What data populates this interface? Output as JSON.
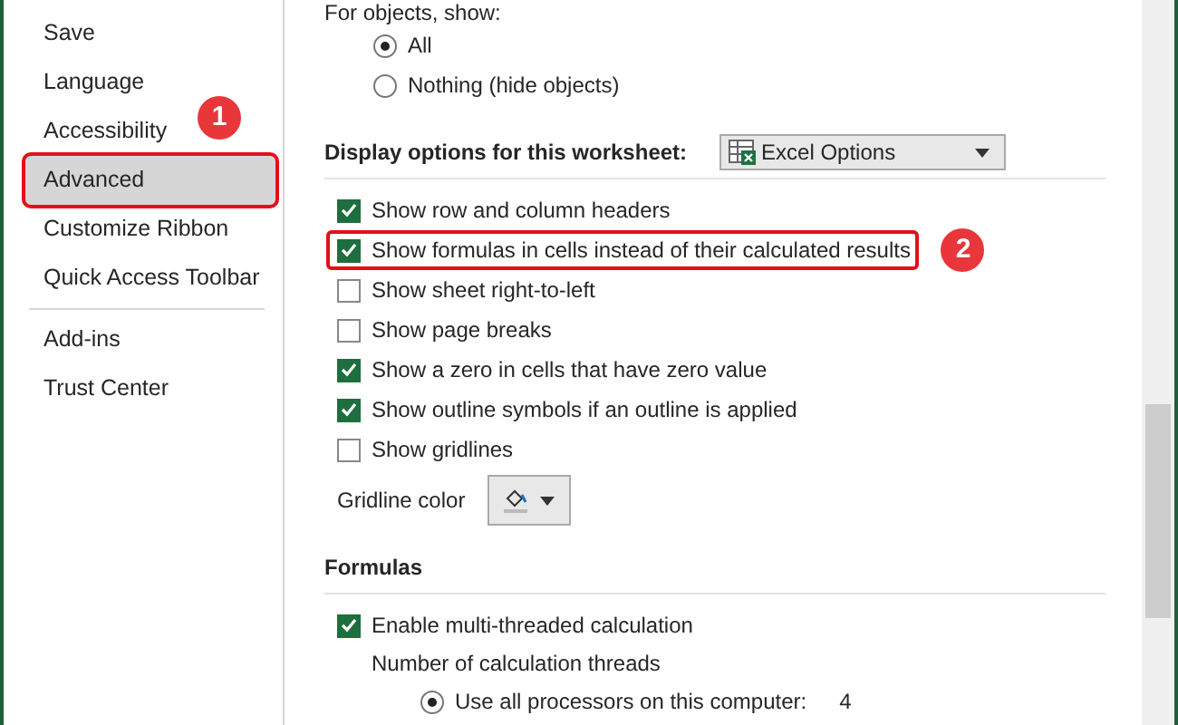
{
  "sidebar": {
    "items": [
      {
        "label": "Save",
        "selected": false
      },
      {
        "label": "Language",
        "selected": false
      },
      {
        "label": "Accessibility",
        "selected": false,
        "badge": "1"
      },
      {
        "label": "Advanced",
        "selected": true,
        "highlighted": true
      },
      {
        "label": "Customize Ribbon",
        "selected": false
      },
      {
        "label": "Quick Access Toolbar",
        "selected": false,
        "divider_after": true
      },
      {
        "label": "Add-ins",
        "selected": false
      },
      {
        "label": "Trust Center",
        "selected": false
      }
    ]
  },
  "objects": {
    "label": "For objects, show:",
    "options": [
      {
        "label": "All",
        "selected": true
      },
      {
        "label": "Nothing (hide objects)",
        "selected": false
      }
    ]
  },
  "display": {
    "heading": "Display options for this worksheet:",
    "dropdown": "Excel Options",
    "checkboxes": [
      {
        "label": "Show row and column headers",
        "checked": true
      },
      {
        "label": "Show formulas in cells instead of their calculated results",
        "checked": true,
        "highlighted": true,
        "badge": "2"
      },
      {
        "label": "Show sheet right-to-left",
        "checked": false
      },
      {
        "label": "Show page breaks",
        "checked": false
      },
      {
        "label": "Show a zero in cells that have zero value",
        "checked": true
      },
      {
        "label": "Show outline symbols if an outline is applied",
        "checked": true
      },
      {
        "label": "Show gridlines",
        "checked": false
      }
    ],
    "gridline_color_label": "Gridline color"
  },
  "formulas": {
    "heading": "Formulas",
    "multithread": {
      "label": "Enable multi-threaded calculation",
      "checked": true
    },
    "threads_label": "Number of calculation threads",
    "options": [
      {
        "label": "Use all processors on this computer:",
        "value": "4",
        "selected": true
      }
    ]
  }
}
